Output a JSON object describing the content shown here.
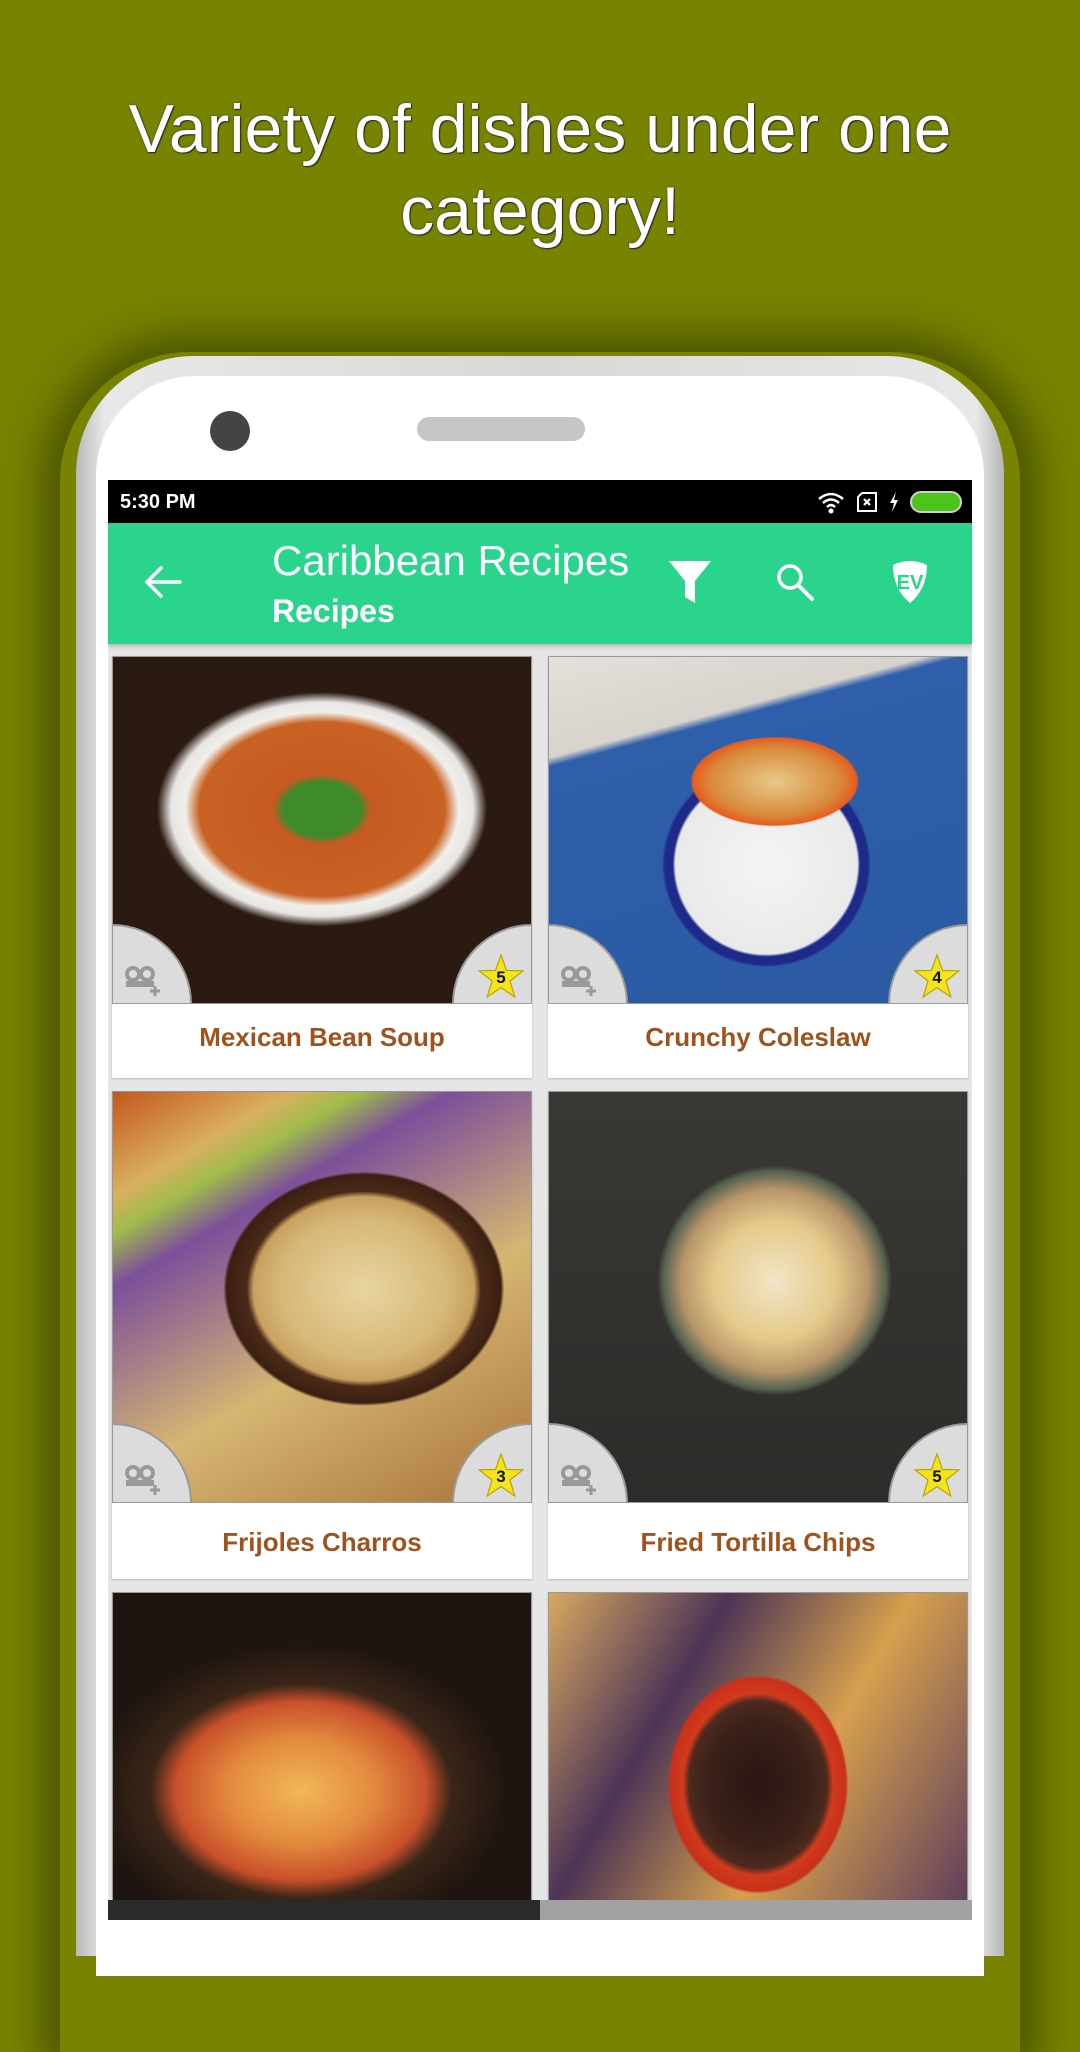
{
  "promo": {
    "line1": "Variety of dishes under one",
    "line2": "category!"
  },
  "status_bar": {
    "time": "5:30 PM",
    "icons": [
      "wifi-icon",
      "no-sim-icon",
      "charging-icon",
      "battery-icon"
    ],
    "battery_color": "#4cc41a"
  },
  "app_bar": {
    "title": "Caribbean Recipes",
    "subtitle": "Recipes",
    "color": "#2bd48d",
    "actions": [
      "back-arrow-icon",
      "filter-icon",
      "search-icon",
      "ev-shield-logo-icon"
    ]
  },
  "recipes": [
    {
      "name": "Mexican Bean Soup",
      "rating": "5",
      "image": "bean soup in white bowl with parsley"
    },
    {
      "name": "Crunchy Coleslaw",
      "rating": "4",
      "image": "coleslaw in white bowl with blue rim"
    },
    {
      "name": "Frijoles Charros",
      "rating": "3",
      "image": "pinto bean stew in clay pot"
    },
    {
      "name": "Fried Tortilla Chips",
      "rating": "5",
      "image": "tortilla chips in dark bowl"
    },
    {
      "name": "",
      "rating": "",
      "image": "tortilla soup in skillet"
    },
    {
      "name": "",
      "rating": "",
      "image": "black bean salsa in red bowl with chips"
    }
  ],
  "colors": {
    "background": "#778301",
    "recipe_title": "#a0521c",
    "star": "#f5e31e"
  }
}
